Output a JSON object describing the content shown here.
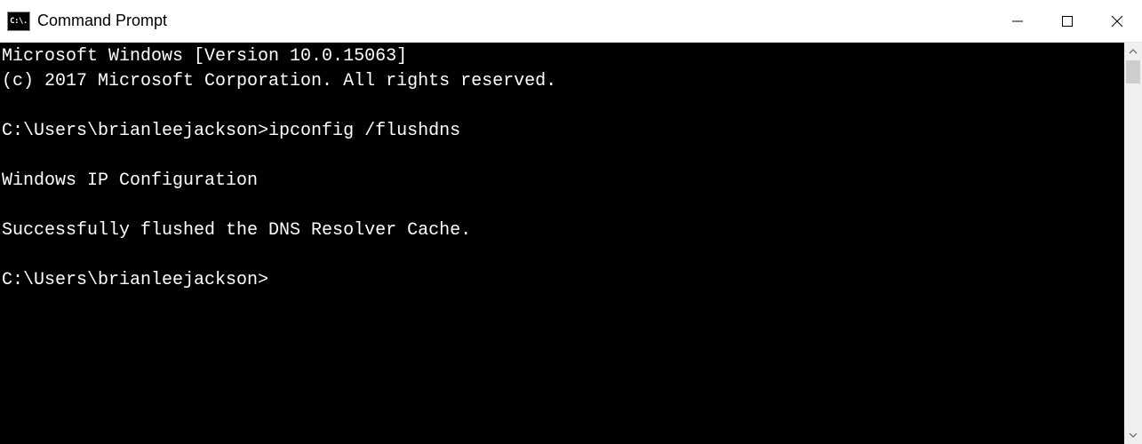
{
  "window": {
    "title": "Command Prompt",
    "icon_label": "C:\\."
  },
  "terminal": {
    "lines": [
      "Microsoft Windows [Version 10.0.15063]",
      "(c) 2017 Microsoft Corporation. All rights reserved.",
      "",
      "C:\\Users\\brianleejackson>ipconfig /flushdns",
      "",
      "Windows IP Configuration",
      "",
      "Successfully flushed the DNS Resolver Cache.",
      "",
      "C:\\Users\\brianleejackson>"
    ]
  }
}
